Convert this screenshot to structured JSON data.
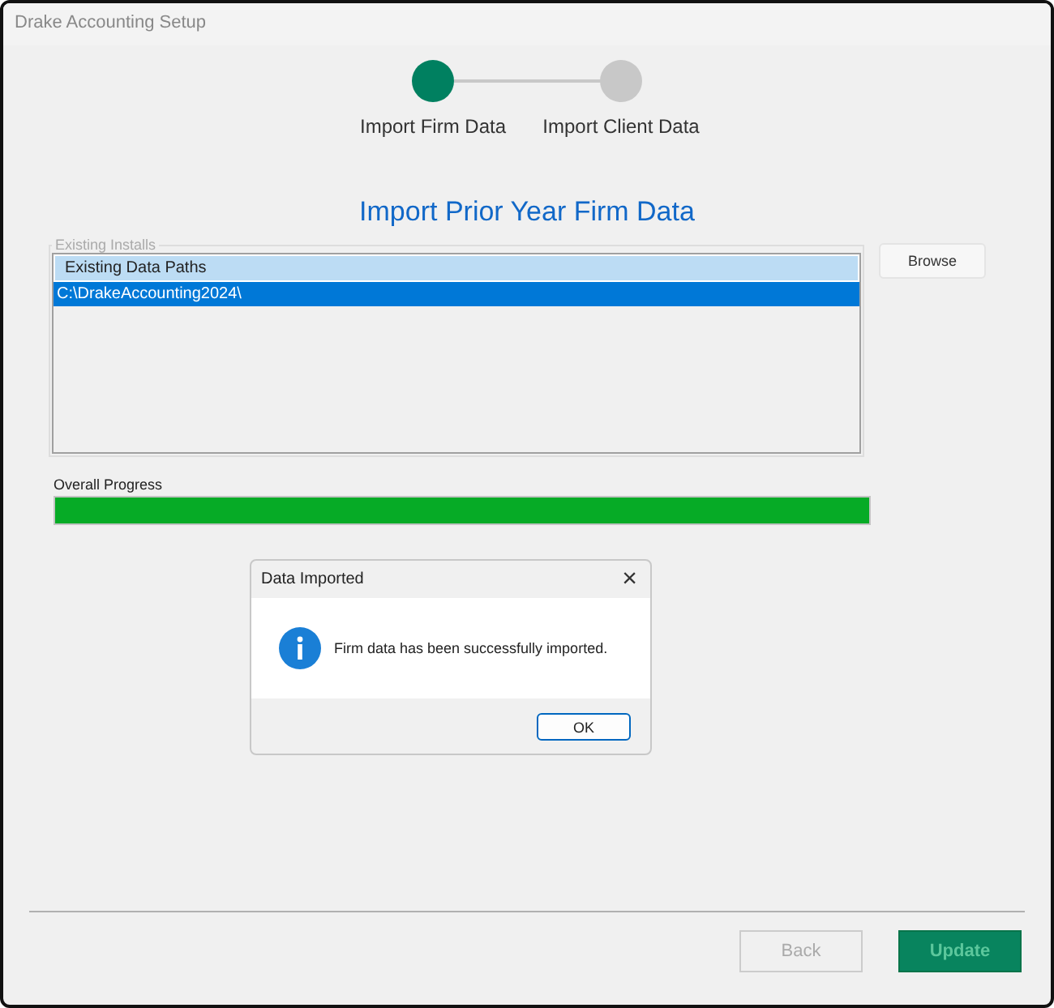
{
  "window": {
    "title": "Drake Accounting Setup"
  },
  "steps": [
    {
      "label": "Import Firm Data",
      "selected": true
    },
    {
      "label": "Import Client Data",
      "selected": false
    }
  ],
  "heading": "Import Prior Year Firm Data",
  "existing_installs": {
    "legend": "Existing Installs",
    "column": "Existing Data Paths",
    "rows": [
      {
        "path": "C:\\DrakeAccounting2024\\",
        "selected": true
      }
    ]
  },
  "browse_button": "Browse",
  "progress": {
    "label": "Overall Progress",
    "level": 1
  },
  "dialog": {
    "title": "Data Imported",
    "close": "×",
    "message": "Firm data has been successfully imported.",
    "button": "OK"
  },
  "buttons": [
    {
      "label": "Back",
      "kind": "secondary",
      "disabled": true
    },
    {
      "label": "Update",
      "kind": "primary",
      "disabled": true
    }
  ]
}
